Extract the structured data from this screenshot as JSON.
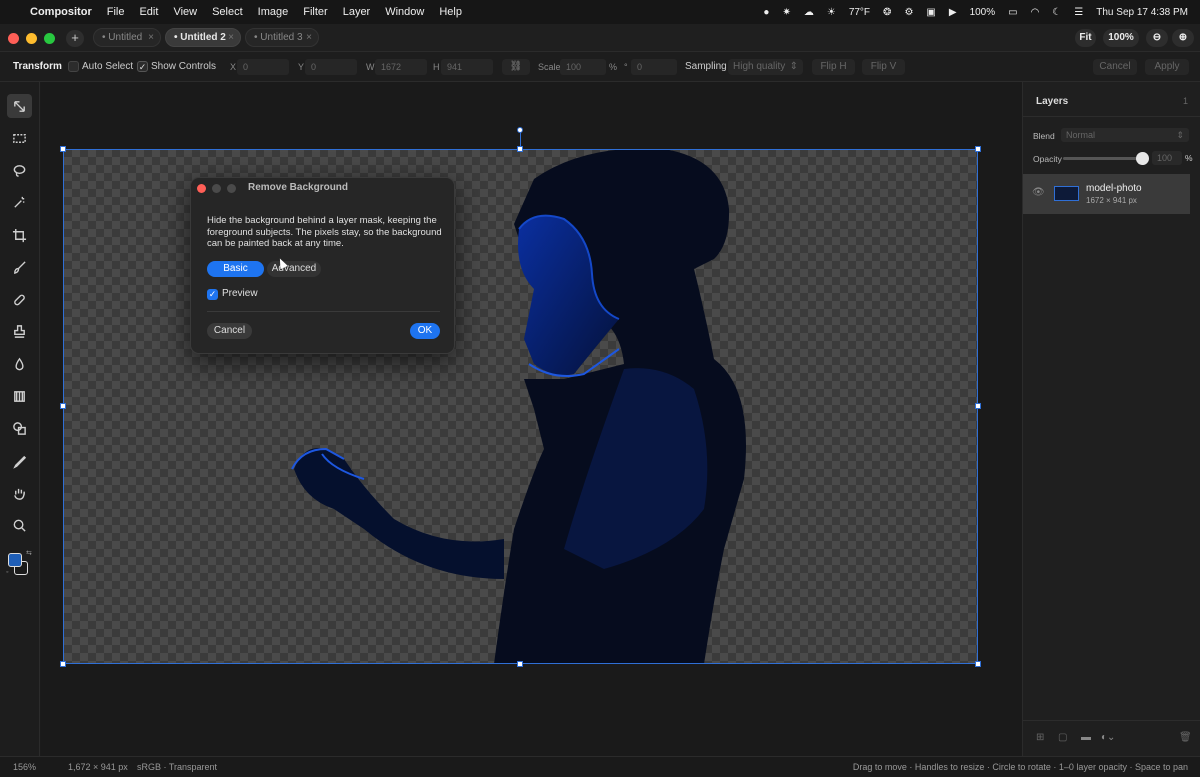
{
  "menubar": {
    "app_name": "Compositor",
    "items": [
      "File",
      "Edit",
      "View",
      "Select",
      "Image",
      "Filter",
      "Layer",
      "Window",
      "Help"
    ],
    "weather": "77°F",
    "battery": "100%",
    "datetime": "Thu Sep 17  4:38 PM"
  },
  "tabs": [
    {
      "label": "Untitled",
      "active": false
    },
    {
      "label": "Untitled 2",
      "active": true
    },
    {
      "label": "Untitled 3",
      "active": false
    }
  ],
  "tab_close_glyph": "×",
  "view": {
    "fit_label": "Fit",
    "zoom_label": "100%"
  },
  "options": {
    "title": "Transform",
    "auto_select_label": "Auto Select",
    "show_controls_label": "Show Controls",
    "x_label": "X",
    "x_value": "0",
    "y_label": "Y",
    "y_value": "0",
    "w_label": "W",
    "w_value": "1672",
    "h_label": "H",
    "h_value": "941",
    "scale_label": "Scale",
    "scale_value": "100",
    "scale_unit": "%",
    "angle_value": "0",
    "angle_unit": "°",
    "sampling_label": "Sampling",
    "sampling_value": "High quality",
    "flip_h": "Flip H",
    "flip_v": "Flip V",
    "cancel": "Cancel",
    "apply": "Apply"
  },
  "dialog": {
    "title": "Remove Background",
    "description": "Hide the background behind a layer mask, keeping the foreground subjects. The pixels stay, so the background can be painted back at any time.",
    "mode_basic": "Basic",
    "mode_advanced": "Advanced",
    "preview_label": "Preview",
    "preview_checked": true,
    "cancel": "Cancel",
    "ok": "OK"
  },
  "panel": {
    "title": "Layers",
    "badge": "1",
    "blend_label": "Blend",
    "blend_value": "Normal",
    "opacity_label": "Opacity",
    "opacity_value": "100",
    "opacity_unit": "%",
    "opacity_level": 1.0,
    "layer": {
      "name": "model-photo",
      "size": "1672 × 941 px"
    }
  },
  "status": {
    "zoom": "156%",
    "dimensions": "1,672 × 941 px",
    "color_space": "sRGB · Transparent",
    "hint": "Drag to move · Handles to resize · Circle to rotate · 1–0 layer opacity · Space to pan"
  },
  "colors": {
    "accent": "#1e74f0",
    "selection": "#2f6fd6",
    "close_red": "#ff5f57",
    "min_yellow": "#febc2e",
    "max_green": "#28c840"
  }
}
